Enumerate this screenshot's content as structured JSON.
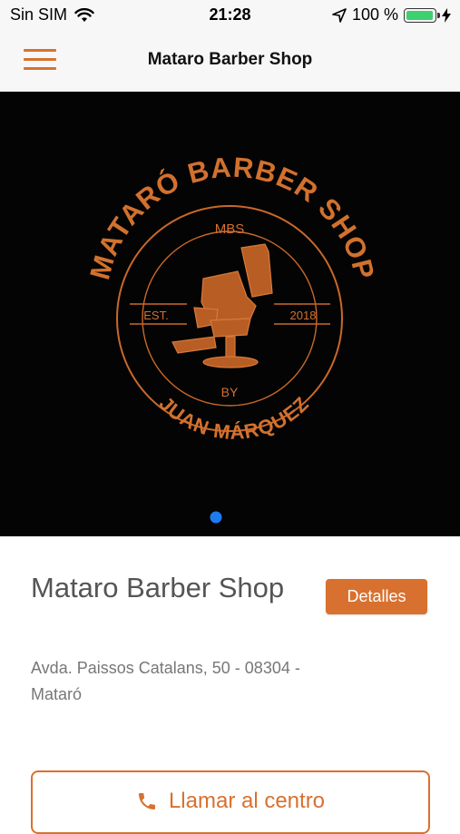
{
  "status_bar": {
    "carrier": "Sin SIM",
    "time": "21:28",
    "battery_percent": "100 %",
    "battery_level": 1.0,
    "icons": [
      "wifi-icon",
      "location-arrow-icon",
      "battery-icon",
      "charging-bolt-icon"
    ]
  },
  "navbar": {
    "title": "Mataro Barber Shop",
    "menu_icon": "hamburger-menu-icon"
  },
  "hero": {
    "logo_text": {
      "top_arc": "MATARÓ BARBER SHOP",
      "monogram": "MBS",
      "est": "EST.",
      "year": "2018",
      "by": "BY",
      "bottom_arc": "JUAN MÁRQUEZ"
    },
    "carousel": {
      "pages": 1,
      "active_index": 0
    }
  },
  "shop": {
    "name": "Mataro Barber Shop",
    "details_label": "Detalles",
    "address": "Avda. Paissos Catalans, 50 - 08304 - Mataró",
    "call_label": "Llamar al centro",
    "call_icon": "phone-icon"
  },
  "colors": {
    "accent": "#d8712f",
    "carousel_dot": "#1f7af0",
    "hero_bg": "#040404"
  }
}
